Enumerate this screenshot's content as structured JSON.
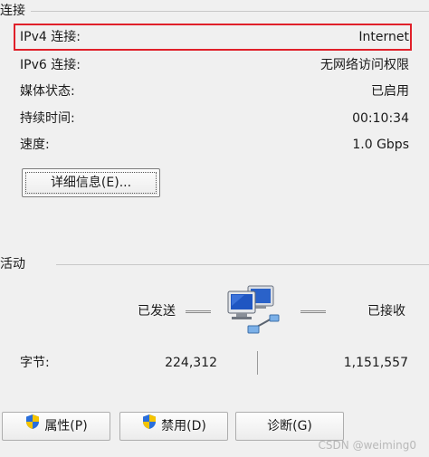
{
  "connection": {
    "group_title": "连接",
    "rows": [
      {
        "label": "IPv4 连接:",
        "value": "Internet"
      },
      {
        "label": "IPv6 连接:",
        "value": "无网络访问权限"
      },
      {
        "label": "媒体状态:",
        "value": "已启用"
      },
      {
        "label": "持续时间:",
        "value": "00:10:34"
      },
      {
        "label": "速度:",
        "value": "1.0 Gbps"
      }
    ],
    "details_button": "详细信息(E)..."
  },
  "activity": {
    "group_title": "活动",
    "sent_label": "已发送",
    "received_label": "已接收",
    "bytes_label": "字节:",
    "bytes_sent": "224,312",
    "bytes_received": "1,151,557",
    "icon": "network-computers-icon"
  },
  "buttons": {
    "properties": "属性(P)",
    "disable": "禁用(D)",
    "diagnose": "诊断(G)",
    "shield_icon": "uac-shield-icon"
  },
  "watermark": "CSDN @weiming0",
  "colors": {
    "highlight_border": "#e0202a",
    "shield_blue": "#2a6fdb",
    "shield_yellow": "#f5c400"
  }
}
